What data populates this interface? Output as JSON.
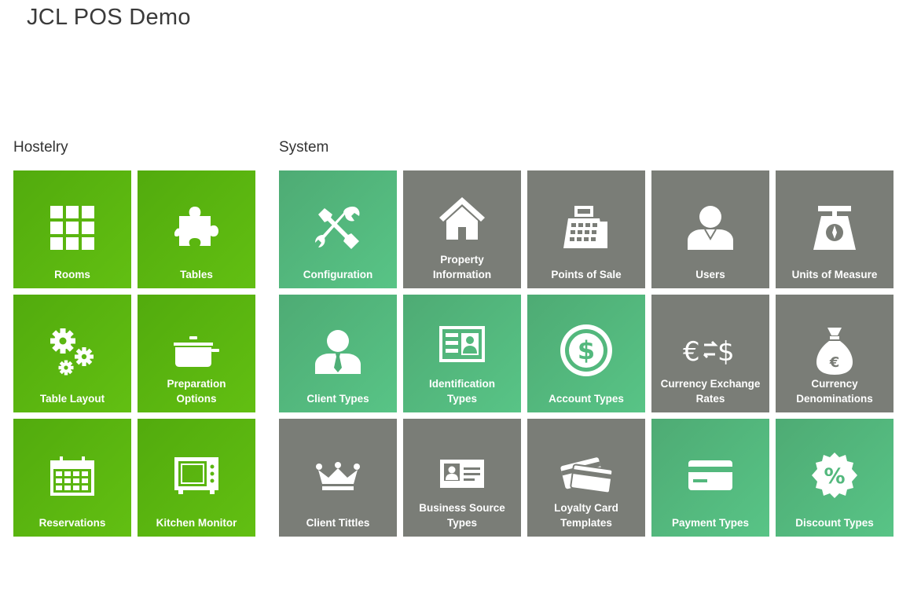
{
  "app": {
    "title": "JCL POS Demo"
  },
  "sections": {
    "hostelry": {
      "title": "Hostelry"
    },
    "system": {
      "title": "System"
    }
  },
  "tiles": {
    "rooms": {
      "label": "Rooms",
      "icon": "grid-icon"
    },
    "tables": {
      "label": "Tables",
      "icon": "puzzle-icon"
    },
    "table_layout": {
      "label": "Table Layout",
      "icon": "gears-icon"
    },
    "preparation_options": {
      "label": "Preparation\nOptions",
      "icon": "cooking-pot-icon"
    },
    "reservations": {
      "label": "Reservations",
      "icon": "calendar-icon"
    },
    "kitchen_monitor": {
      "label": "Kitchen Monitor",
      "icon": "microwave-icon"
    },
    "configuration": {
      "label": "Configuration",
      "icon": "tools-icon"
    },
    "property_information": {
      "label": "Property\nInformation",
      "icon": "house-icon"
    },
    "points_of_sale": {
      "label": "Points of Sale",
      "icon": "cash-register-icon"
    },
    "users": {
      "label": "Users",
      "icon": "user-icon"
    },
    "units_of_measure": {
      "label": "Units of Measure",
      "icon": "scale-icon"
    },
    "client_types": {
      "label": "Client Types",
      "icon": "person-tie-icon"
    },
    "identification_types": {
      "label": "Identification\nTypes",
      "icon": "id-card-icon"
    },
    "account_types": {
      "label": "Account Types",
      "icon": "dollar-coin-icon"
    },
    "currency_exchange_rates": {
      "label": "Currency Exchange\nRates",
      "icon": "currency-exchange-icon"
    },
    "currency_denominations": {
      "label": "Currency\nDenominations",
      "icon": "money-bag-icon"
    },
    "client_titles": {
      "label": "Client Tittles",
      "icon": "crown-icon"
    },
    "business_source_types": {
      "label": "Business Source\nTypes",
      "icon": "business-card-icon"
    },
    "loyalty_card_templates": {
      "label": "Loyalty Card\nTemplates",
      "icon": "cards-icon"
    },
    "payment_types": {
      "label": "Payment Types",
      "icon": "credit-card-icon"
    },
    "discount_types": {
      "label": "Discount Types",
      "icon": "percent-badge-icon"
    }
  },
  "colors": {
    "lime": "#5cb812",
    "mint": "#53b87d",
    "gray": "#7a7d77"
  }
}
